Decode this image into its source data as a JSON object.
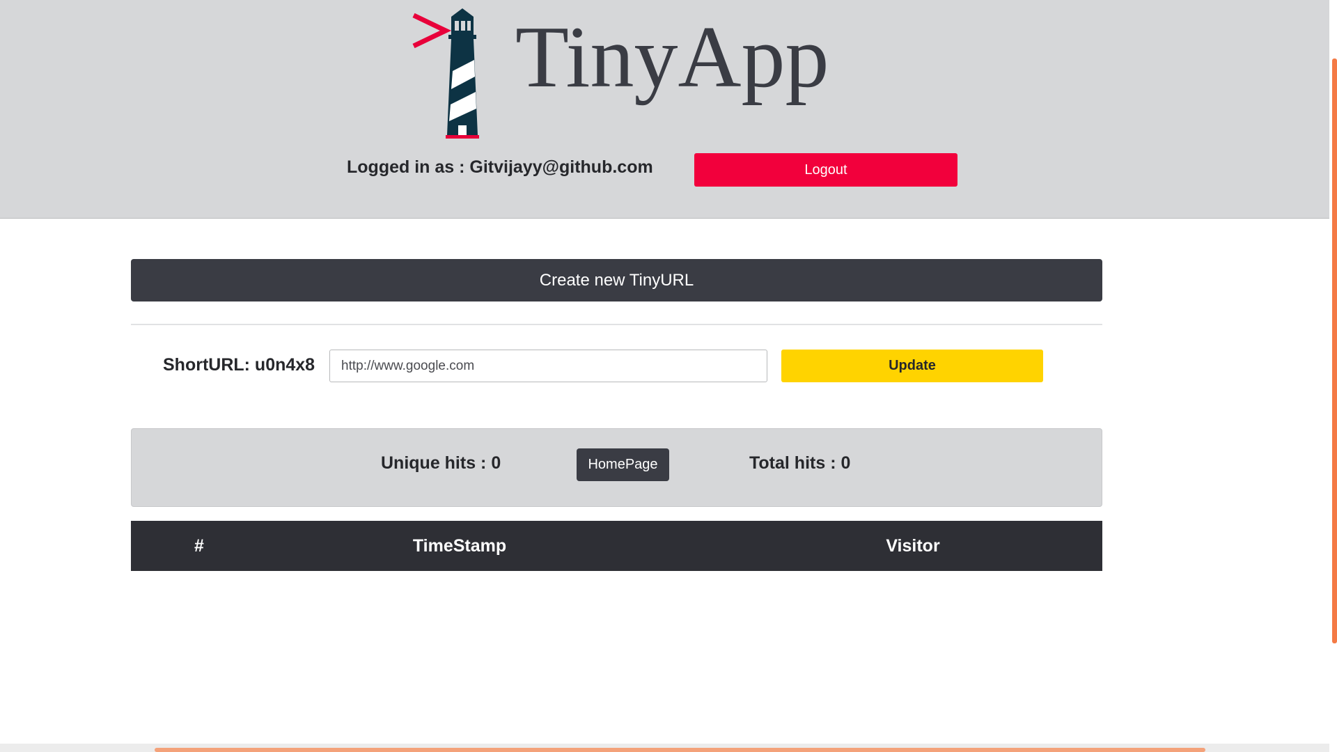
{
  "header": {
    "brand": "TinyApp",
    "logged_in_text": "Logged in as : Gitvijayy@github.com",
    "logout_label": "Logout"
  },
  "create_bar_label": "Create new TinyURL",
  "edit": {
    "short_url_label": "ShortURL: u0n4x8",
    "long_url_value": "http://www.google.com",
    "update_label": "Update"
  },
  "stats": {
    "unique_hits": "Unique hits : 0",
    "homepage_label": "HomePage",
    "total_hits": "Total hits : 0"
  },
  "table": {
    "columns": [
      "#",
      "TimeStamp",
      "Visitor"
    ],
    "rows": []
  },
  "colors": {
    "logout": "#f2003c",
    "update": "#ffd300",
    "dark": "#3a3c44",
    "header_bg": "#d6d7d9",
    "scroll_accent": "#f47a45"
  },
  "icons": {
    "logo": "lighthouse-icon"
  }
}
